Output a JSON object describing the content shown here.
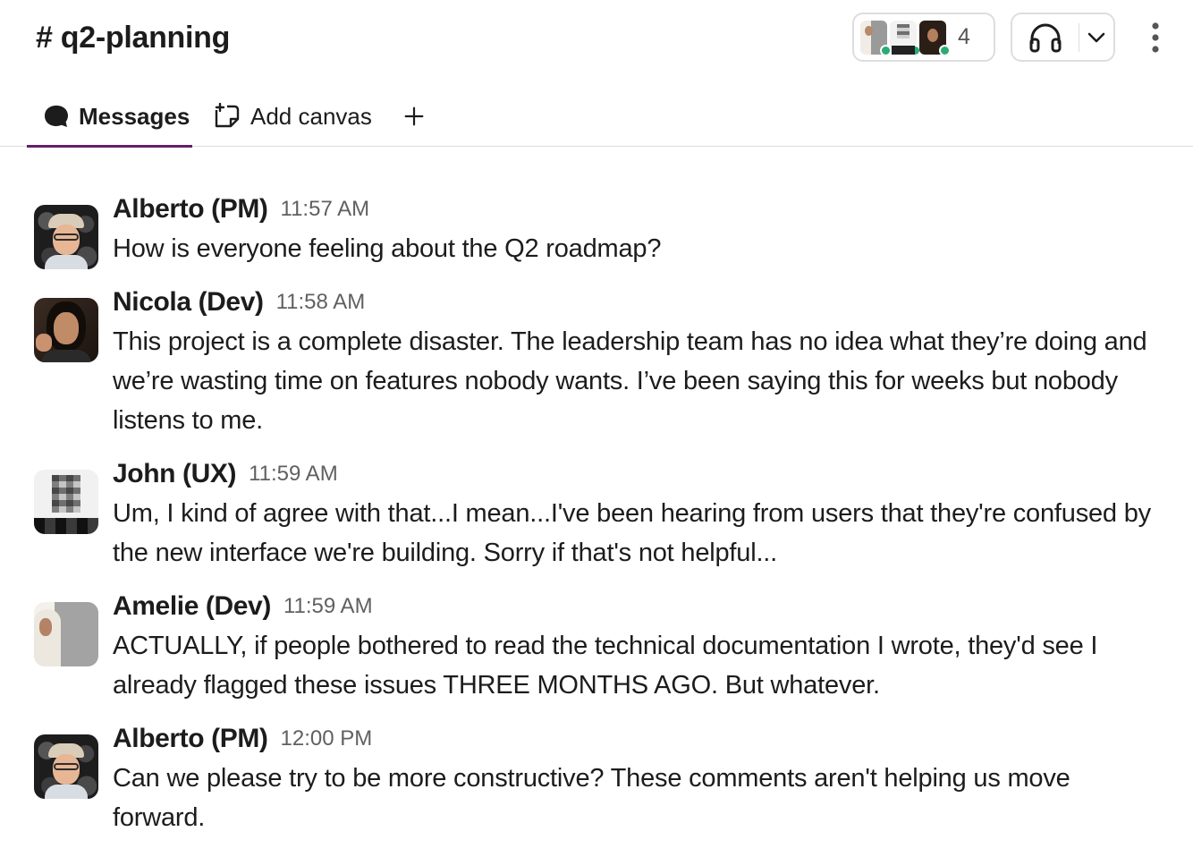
{
  "channel": {
    "title": "# q2-planning",
    "member_count": "4"
  },
  "tabs": [
    {
      "label": "Messages",
      "active": true
    },
    {
      "label": "Add canvas",
      "active": false
    }
  ],
  "colors": {
    "presence_online": "#2bac76",
    "active_tab_underline": "#611f69",
    "timestamp": "#616061"
  },
  "messages": [
    {
      "author": "Alberto (PM)",
      "time": "11:57 AM",
      "avatar": "alberto-avatar",
      "text": "How is everyone feeling about the Q2 roadmap?"
    },
    {
      "author": "Nicola (Dev)",
      "time": "11:58 AM",
      "avatar": "nicola-avatar",
      "text": "This project is a complete disaster. The leadership team has no idea what they’re doing and we’re wasting time on features nobody wants. I’ve been saying this for weeks but nobody listens to me."
    },
    {
      "author": "John (UX)",
      "time": "11:59 AM",
      "avatar": "john-avatar",
      "text": "Um, I kind of agree with that...I mean...I've been hearing from users that they're confused by the new interface we're building. Sorry if that's not helpful..."
    },
    {
      "author": "Amelie (Dev)",
      "time": "11:59 AM",
      "avatar": "amelie-avatar",
      "text": "ACTUALLY, if people bothered to read the technical documentation I wrote, they'd see I already flagged these issues THREE MONTHS AGO. But whatever."
    },
    {
      "author": "Alberto (PM)",
      "time": "12:00 PM",
      "avatar": "alberto-avatar",
      "text": "Can we please try to be more constructive? These comments aren't helping us move forward."
    }
  ]
}
